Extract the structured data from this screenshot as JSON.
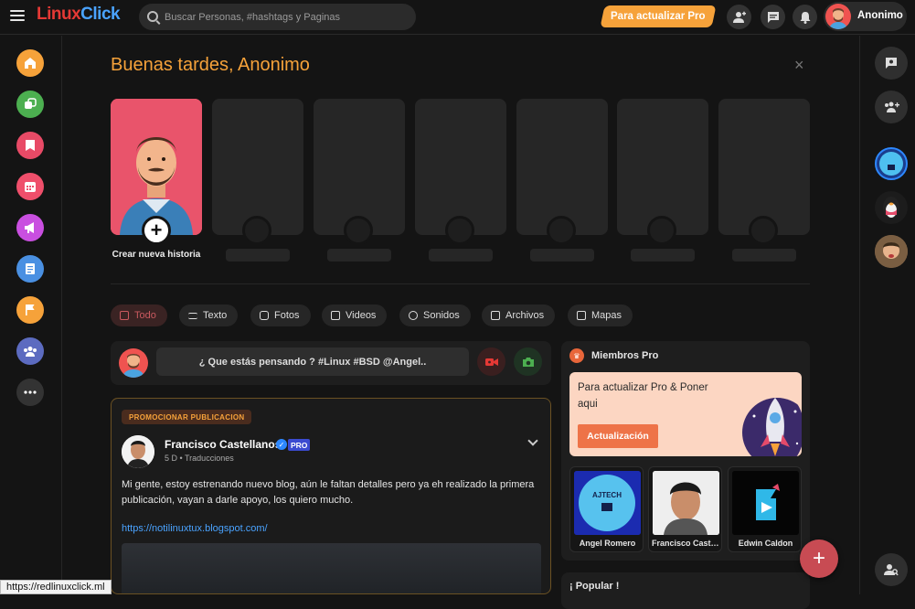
{
  "header": {
    "logo_part1": "Linux",
    "logo_part2": "Click",
    "search_placeholder": "Buscar Personas, #hashtags y Paginas",
    "pro_button": "Para actualizar Pro",
    "username": "Anonimo"
  },
  "colors": {
    "accent": "#f6a23a",
    "brand_red": "#e53935",
    "brand_blue": "#4aa3ff",
    "fab": "#c84b53"
  },
  "left_sidebar": [
    {
      "icon": "home-icon",
      "color": "#f6a23a"
    },
    {
      "icon": "groups-icon",
      "color": "#4caf50"
    },
    {
      "icon": "saved-icon",
      "color": "#e84a66"
    },
    {
      "icon": "calendar-icon",
      "color": "#ef4f6b"
    },
    {
      "icon": "megaphone-icon",
      "color": "#c94fe0"
    },
    {
      "icon": "news-icon",
      "color": "#4a90e2"
    },
    {
      "icon": "flag-icon",
      "color": "#f6a23a"
    },
    {
      "icon": "community-icon",
      "color": "#5c6bc0"
    },
    {
      "icon": "more-icon",
      "color": "#333333"
    }
  ],
  "greeting": "Buenas tardes, Anonimo",
  "stories": {
    "create_label": "Crear nueva historia"
  },
  "tabs": [
    {
      "label": "Todo",
      "icon": "document-icon"
    },
    {
      "label": "Texto",
      "icon": "text-icon"
    },
    {
      "label": "Fotos",
      "icon": "camera-icon"
    },
    {
      "label": "Videos",
      "icon": "video-icon"
    },
    {
      "label": "Sonidos",
      "icon": "music-icon"
    },
    {
      "label": "Archivos",
      "icon": "file-icon"
    },
    {
      "label": "Mapas",
      "icon": "map-icon"
    }
  ],
  "composer": {
    "placeholder": "¿ Que estás pensando ? #Linux #BSD @Angel.."
  },
  "post": {
    "promo_label": "PROMOCIONAR PUBLICACION",
    "author": "Francisco Castellanos",
    "badge": "PRO",
    "time": "5 D",
    "translate": "Traducciones",
    "text": "Mi gente, estoy estrenando nuevo blog, aún le faltan detalles pero ya eh realizado la primera publicación, vayan a darle apoyo, los quiero mucho.",
    "link": "https://notilinuxtux.blogspot.com/"
  },
  "pro_members": {
    "title": "Miembros Pro",
    "upgrade_text": "Para actualizar Pro & Poner aqui",
    "upgrade_button": "Actualización",
    "members": [
      {
        "name": "Angel Romero",
        "avatar_text": "AJTECH"
      },
      {
        "name": "Francisco Castellanos"
      },
      {
        "name": "Edwin Caldon"
      }
    ]
  },
  "popular": {
    "title": "¡ Popular !"
  },
  "status_url": "https://redlinuxclick.ml"
}
